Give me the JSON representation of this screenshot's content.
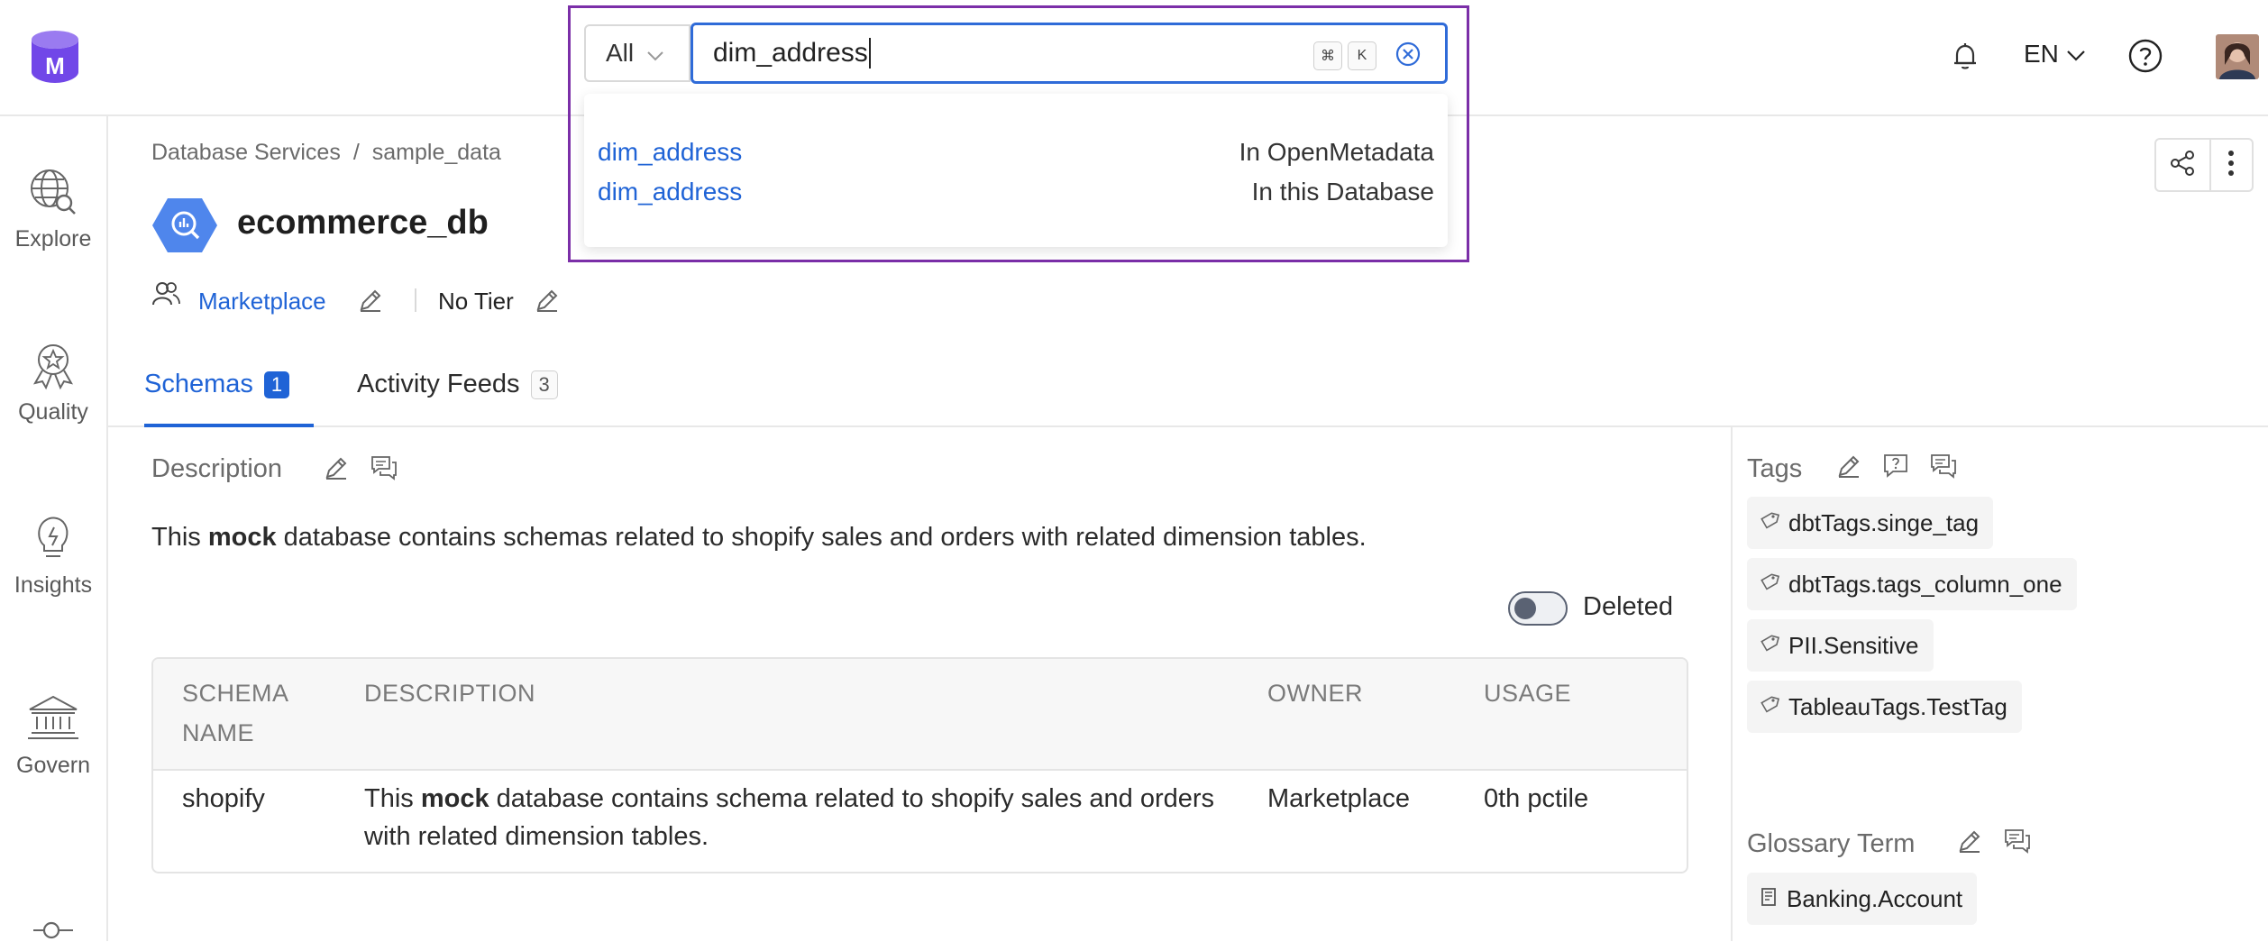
{
  "nav": {
    "language": "EN",
    "search": {
      "scope": "All",
      "query": "dim_address",
      "shortcut_keys": [
        "⌘",
        "K"
      ],
      "suggestions": [
        {
          "name": "dim_address",
          "scope": "In OpenMetadata"
        },
        {
          "name": "dim_address",
          "scope": "In this Database"
        }
      ]
    }
  },
  "sidebar": {
    "items": [
      {
        "label": "Explore",
        "icon": "globe-search-icon"
      },
      {
        "label": "Quality",
        "icon": "award-icon"
      },
      {
        "label": "Insights",
        "icon": "bulb-icon"
      },
      {
        "label": "Govern",
        "icon": "bank-icon"
      }
    ]
  },
  "breadcrumb": {
    "items": [
      "Database Services",
      "sample_data"
    ],
    "separator": "/"
  },
  "entity": {
    "name": "ecommerce_db",
    "owner": "Marketplace",
    "tier": "No Tier"
  },
  "tabs": [
    {
      "label": "Schemas",
      "count": "1",
      "active": true
    },
    {
      "label": "Activity Feeds",
      "count": "3",
      "active": false
    }
  ],
  "description": {
    "heading": "Description",
    "text_before": "This ",
    "text_bold": "mock",
    "text_after": " database contains schemas related to shopify sales and orders with related dimension tables."
  },
  "deleted_toggle": {
    "label": "Deleted",
    "on": false
  },
  "schema_table": {
    "headers": [
      "SCHEMA NAME",
      "DESCRIPTION",
      "OWNER",
      "USAGE"
    ],
    "rows": [
      {
        "name": "shopify",
        "desc_before": "This ",
        "desc_bold": "mock",
        "desc_after": " database contains schema related to shopify sales and orders with related dimension tables.",
        "owner": "Marketplace",
        "usage": "0th pctile"
      }
    ]
  },
  "tags_panel": {
    "heading": "Tags",
    "tags": [
      "dbtTags.singe_tag",
      "dbtTags.tags_column_one",
      "PII.Sensitive",
      "TableauTags.TestTag"
    ]
  },
  "glossary_panel": {
    "heading": "Glossary Term",
    "terms": [
      "Banking.Account"
    ]
  },
  "colors": {
    "accent": "#1f63d6",
    "search_highlight": "#7b2fa8",
    "logo_purple": "#7147e8"
  }
}
